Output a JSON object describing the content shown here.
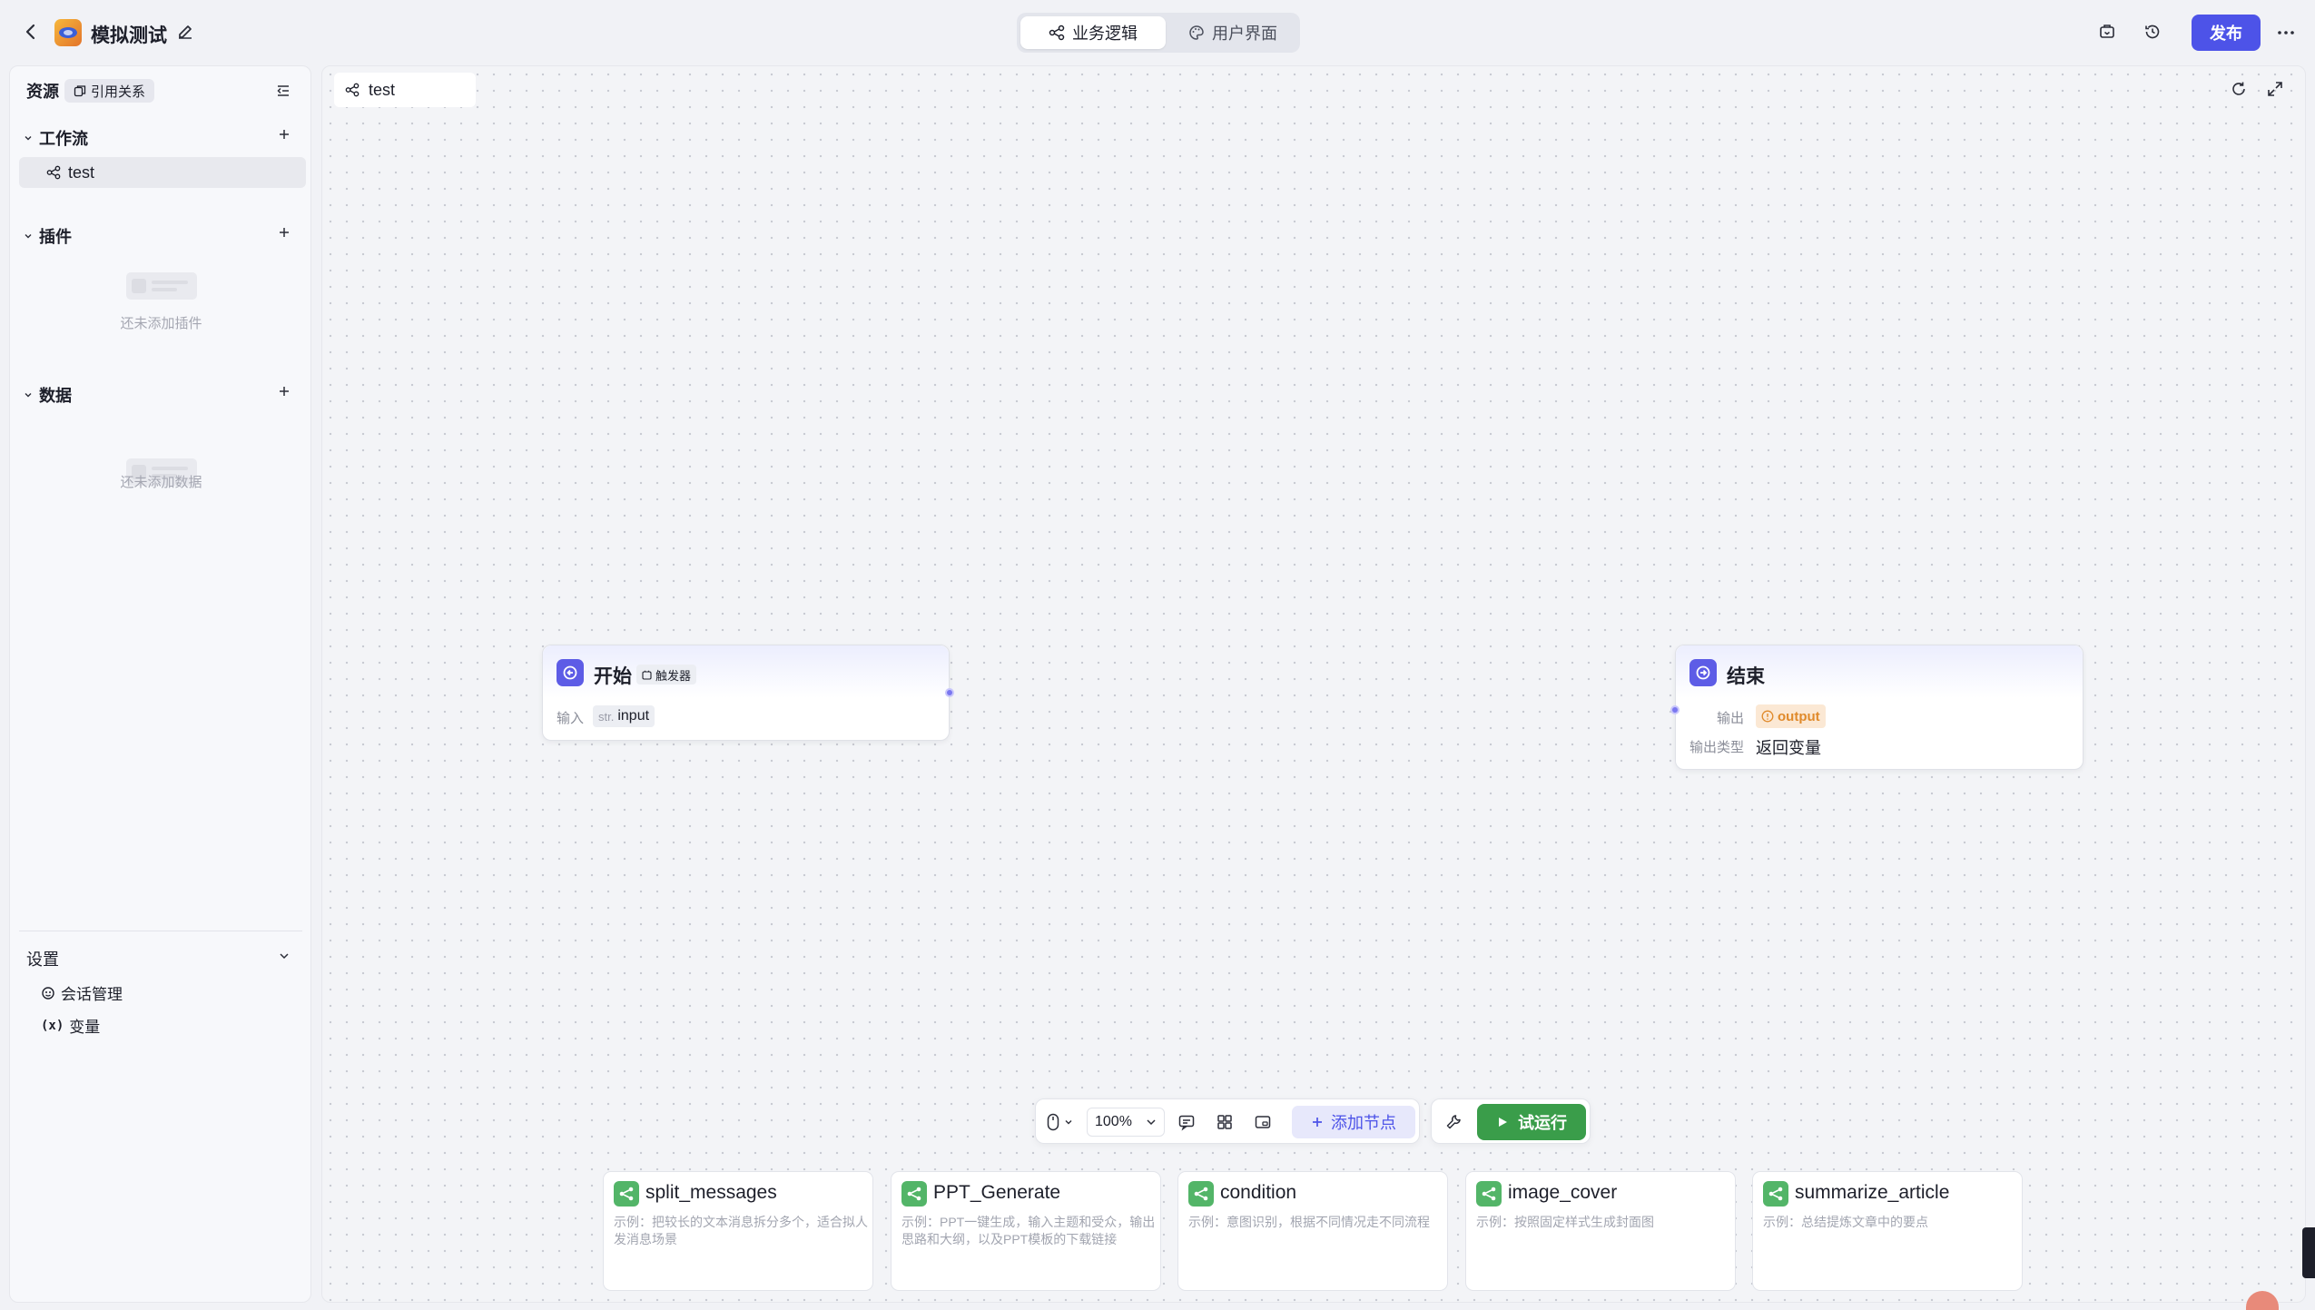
{
  "header": {
    "title": "模拟测试",
    "tabs": [
      {
        "label": "业务逻辑"
      },
      {
        "label": "用户界面"
      }
    ],
    "publish_label": "发布",
    "colors": {
      "accent": "#4d53e8"
    }
  },
  "sidebar": {
    "title": "资源",
    "ref_label": "引用关系",
    "sections": {
      "workflow": {
        "title": "工作流",
        "items": [
          {
            "label": "test"
          }
        ]
      },
      "plugin": {
        "title": "插件",
        "empty": "还未添加插件"
      },
      "data": {
        "title": "数据",
        "empty": "还未添加数据"
      }
    },
    "settings": {
      "title": "设置",
      "items": [
        {
          "label": "会话管理"
        },
        {
          "label": "变量"
        }
      ]
    }
  },
  "canvas": {
    "tab_label": "test",
    "start_node": {
      "title": "开始",
      "badge": "触发器",
      "input_label": "输入",
      "var_type": "str.",
      "var_name": "input"
    },
    "end_node": {
      "title": "结束",
      "output_label": "输出",
      "output_var": "output",
      "output_type_label": "输出类型",
      "output_type_value": "返回变量"
    }
  },
  "toolbar": {
    "zoom": "100%",
    "add_node": "添加节点",
    "run": "试运行"
  },
  "templates": [
    {
      "name": "split_messages",
      "desc": "示例：把较长的文本消息拆分多个，适合拟人发消息场景"
    },
    {
      "name": "PPT_Generate",
      "desc": "示例：PPT一键生成，输入主题和受众，输出思路和大纲，以及PPT模板的下载链接"
    },
    {
      "name": "condition",
      "desc": "示例：意图识别，根据不同情况走不同流程"
    },
    {
      "name": "image_cover",
      "desc": "示例：按照固定样式生成封面图"
    },
    {
      "name": "summarize_article",
      "desc": "示例：总结提炼文章中的要点"
    }
  ]
}
